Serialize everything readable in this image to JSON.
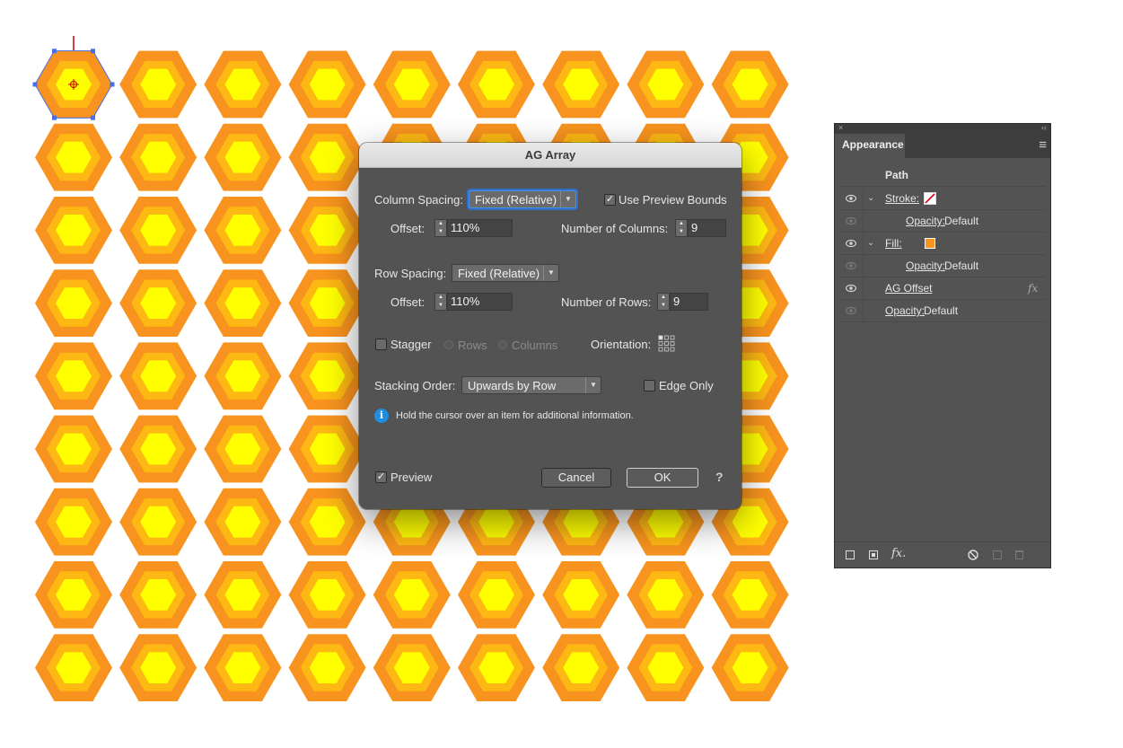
{
  "canvas": {
    "colors": {
      "outer": "#f7931e",
      "middle": "#fdb813",
      "inner": "#ffff00",
      "selection": "#4a6fe3",
      "crosshair": "#cc0000"
    }
  },
  "dialog": {
    "title": "AG Array",
    "column_spacing_label": "Column Spacing:",
    "column_spacing_value": "Fixed (Relative)",
    "use_preview_bounds_label": "Use Preview Bounds",
    "use_preview_bounds_checked": true,
    "col_offset_label": "Offset:",
    "col_offset_value": "110%",
    "num_columns_label": "Number of Columns:",
    "num_columns_value": "9",
    "row_spacing_label": "Row Spacing:",
    "row_spacing_value": "Fixed (Relative)",
    "row_offset_label": "Offset:",
    "row_offset_value": "110%",
    "num_rows_label": "Number of Rows:",
    "num_rows_value": "9",
    "stagger_label": "Stagger",
    "stagger_checked": false,
    "stagger_rows_label": "Rows",
    "stagger_columns_label": "Columns",
    "orientation_label": "Orientation:",
    "stacking_order_label": "Stacking Order:",
    "stacking_order_value": "Upwards by Row",
    "edge_only_label": "Edge Only",
    "edge_only_checked": false,
    "info_text": "Hold the cursor over an item for additional information.",
    "info_icon_glyph": "i",
    "preview_label": "Preview",
    "preview_checked": true,
    "cancel_label": "Cancel",
    "ok_label": "OK",
    "help_label": "?",
    "checkmark": "✓",
    "dropdown_arrow": "▼",
    "spin_up": "▲",
    "spin_down": "▼"
  },
  "appearance_panel": {
    "close_glyph": "×",
    "collapse_glyph": "‹‹",
    "tab_label": "Appearance",
    "menu_glyph": "≡",
    "header": "Path",
    "chevron": "⌄",
    "rows": [
      {
        "label": "Stroke:",
        "swatch": "none-red-slash",
        "visible": true
      },
      {
        "label": "Opacity:",
        "value": "Default",
        "visible": false
      },
      {
        "label": "Fill:",
        "swatch": "#f7931e",
        "visible": true
      },
      {
        "label": "Opacity:",
        "value": "Default",
        "visible": false
      },
      {
        "label": "AG Offset",
        "fx": "fx",
        "visible": true
      },
      {
        "label": "Opacity:",
        "value": "Default",
        "visible": false
      }
    ],
    "footer_icons": [
      "new-stroke-icon",
      "new-fill-icon",
      "fx-menu-icon",
      "clear-appearance-icon",
      "duplicate-item-icon",
      "delete-item-icon"
    ],
    "footer_fx": "fx."
  }
}
